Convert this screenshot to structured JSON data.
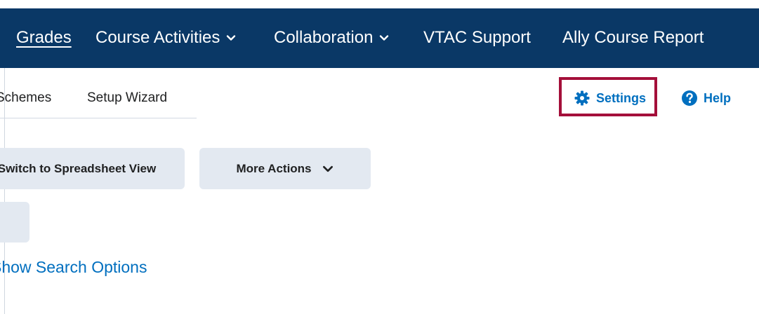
{
  "nav": {
    "items": [
      {
        "label": "Grades",
        "active": true,
        "dropdown": false
      },
      {
        "label": "Course Activities",
        "active": false,
        "dropdown": true
      },
      {
        "label": "Collaboration",
        "active": false,
        "dropdown": true
      },
      {
        "label": "VTAC Support",
        "active": false,
        "dropdown": false
      },
      {
        "label": "Ally Course Report",
        "active": false,
        "dropdown": false
      }
    ]
  },
  "subnav": {
    "tabs": [
      {
        "label": "Schemes"
      },
      {
        "label": "Setup Wizard"
      }
    ],
    "settings_label": "Settings",
    "help_label": "Help"
  },
  "actions": {
    "switch_view_label": "Switch to Spreadsheet View",
    "more_actions_label": "More Actions"
  },
  "search": {
    "toggle_label": "Show Search Options"
  },
  "colors": {
    "nav_bg": "#0a3866",
    "link": "#006fbf",
    "highlight": "#a40f3a",
    "button_bg": "#e3e9f1"
  }
}
